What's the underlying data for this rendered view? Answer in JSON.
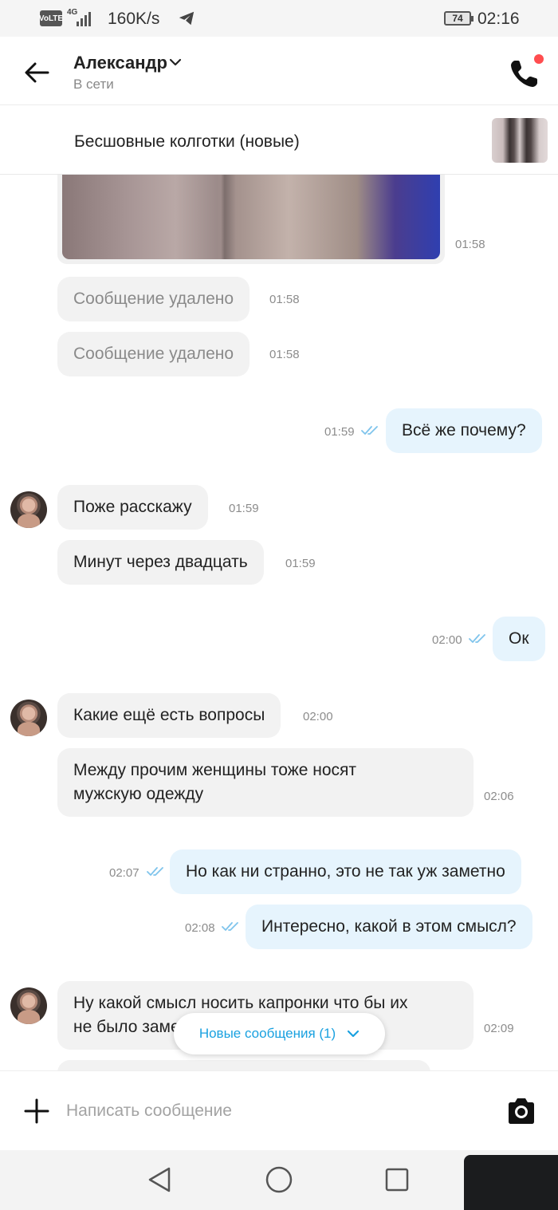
{
  "status_bar": {
    "volte": "VoLTE",
    "network": "4G",
    "speed": "160K/s",
    "battery": "74",
    "time": "02:16"
  },
  "header": {
    "contact_name": "Александр",
    "contact_status": "В сети",
    "icons": {
      "back": "arrow-left-icon",
      "chevron": "chevron-down-icon",
      "call": "phone-icon"
    }
  },
  "product": {
    "title": "Бесшовные колготки (новые)"
  },
  "messages": [
    {
      "dir": "in",
      "type": "photo",
      "time": "01:58"
    },
    {
      "dir": "in",
      "text": "Сообщение удалено",
      "deleted": true,
      "time": "01:58"
    },
    {
      "dir": "in",
      "text": "Сообщение удалено",
      "deleted": true,
      "time": "01:58"
    },
    {
      "dir": "out",
      "text": "Всё же почему?",
      "time": "01:59",
      "read": true
    },
    {
      "dir": "in",
      "text": "Поже расскажу",
      "time": "01:59"
    },
    {
      "dir": "in",
      "text": "Минут через двадцать",
      "time": "01:59"
    },
    {
      "dir": "out",
      "text": "Ок",
      "time": "02:00",
      "read": true
    },
    {
      "dir": "in",
      "text": "Какие ещё есть вопросы",
      "time": "02:00"
    },
    {
      "dir": "in",
      "text_line1": "Между прочим женщины тоже носят",
      "text_line2": "мужскую одежду",
      "time": "02:06"
    },
    {
      "dir": "out",
      "text": "Но как ни странно, это не так уж заметно",
      "time": "02:07",
      "read": true
    },
    {
      "dir": "out",
      "text": "Интересно, какой в этом смысл?",
      "time": "02:08",
      "read": true
    },
    {
      "dir": "in",
      "text_line1": "Ну какой смысл носить капронки что бы их",
      "text_line2": "не было заметно",
      "time": "02:09"
    }
  ],
  "new_messages_pill": {
    "label": "Новые сообщения (1)"
  },
  "composer": {
    "placeholder": "Написать сообщение",
    "icons": {
      "attach": "plus-icon",
      "camera": "camera-icon"
    }
  },
  "nav_bar": {
    "icons": {
      "back": "nav-back-icon",
      "home": "nav-home-icon",
      "recent": "nav-recent-icon"
    }
  },
  "colors": {
    "incoming_bubble": "#f2f2f2",
    "outgoing_bubble": "#e6f4fd",
    "accent": "#1aa1e0",
    "call_badge": "#ff4d4f"
  }
}
